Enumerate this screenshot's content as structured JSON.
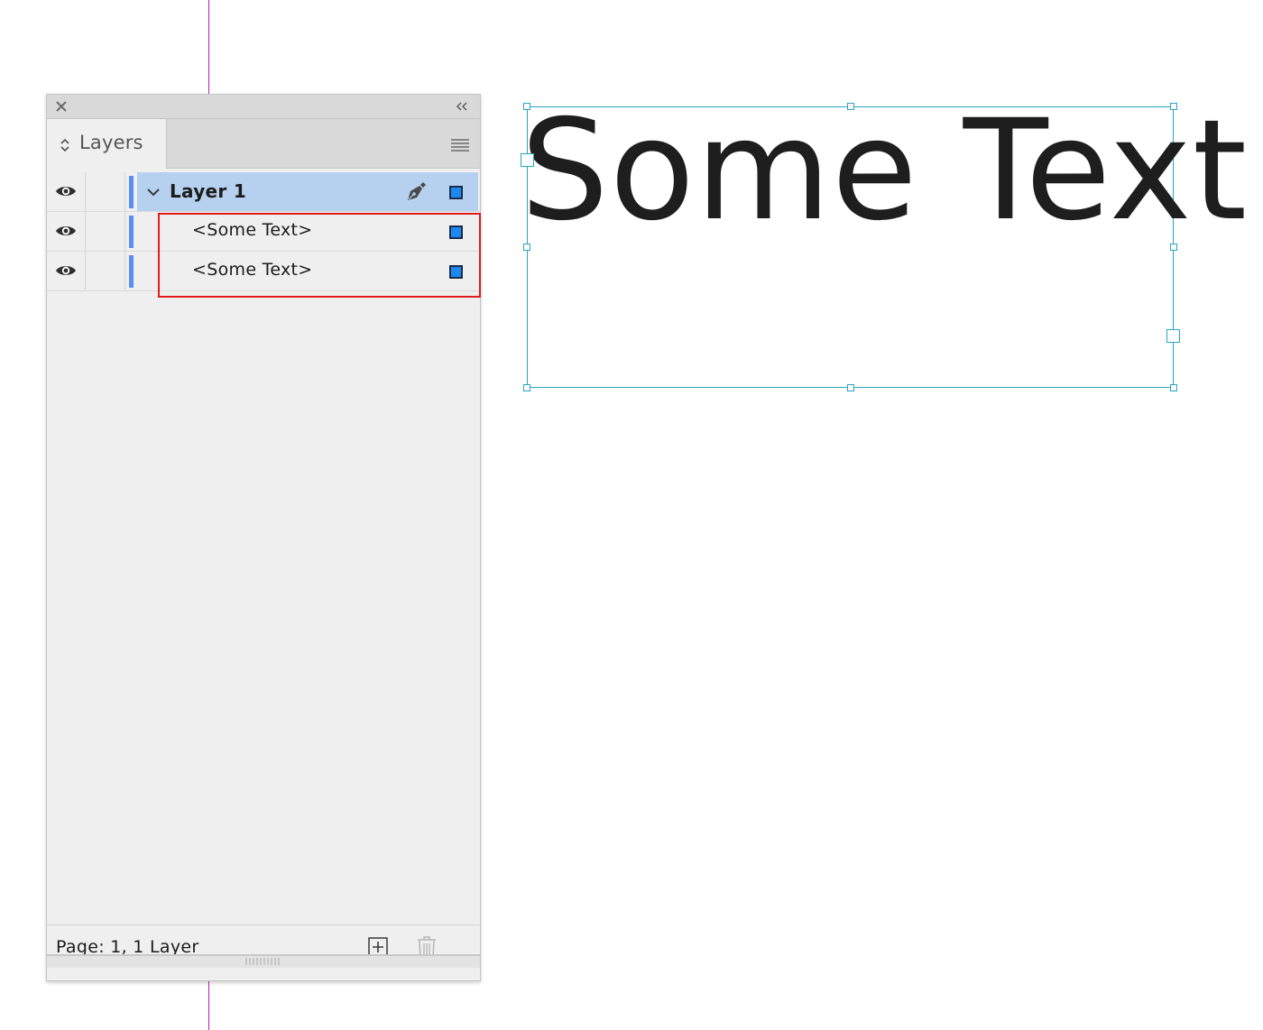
{
  "panel": {
    "tab_label": "Layers",
    "layers": [
      {
        "name": "Layer 1",
        "visible": true,
        "expanded": true,
        "color": "#5b8ef5",
        "items": [
          {
            "name": "<Some Text>",
            "visible": true
          },
          {
            "name": "<Some Text>",
            "visible": true
          }
        ]
      }
    ],
    "footer_status": "Page: 1, 1 Layer"
  },
  "canvas": {
    "frame_text": "Some Text"
  },
  "colors": {
    "selection_row": "#b6d1ef",
    "layer_color": "#5b8ef5",
    "frame_edge": "#2aa4c2",
    "highlight": "#e01d1d",
    "guide": "#b31fb5"
  },
  "icons": {
    "close": "close-icon",
    "collapse": "double-chevron-left-icon",
    "tab_sort": "up-down-arrows-icon",
    "menu": "hamburger-menu-icon",
    "visibility": "eye-icon",
    "expand": "chevron-down-icon",
    "edit": "pen-nib-icon",
    "new_layer": "new-layer-icon",
    "delete": "trash-icon",
    "grip": "resize-grip-icon"
  }
}
